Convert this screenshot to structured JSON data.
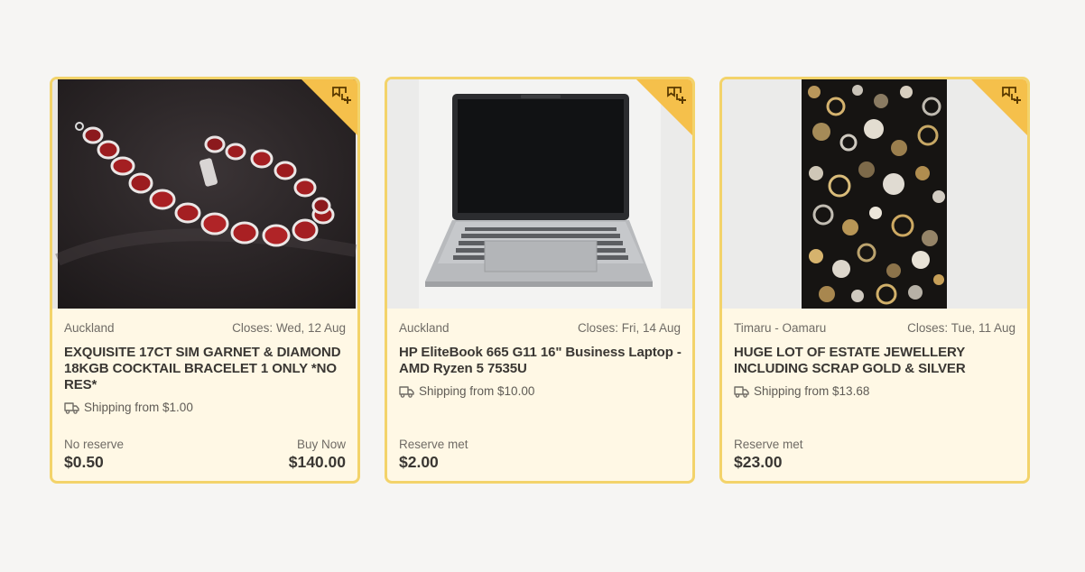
{
  "listings": [
    {
      "location": "Auckland",
      "closes": "Closes: Wed, 12 Aug",
      "title": "EXQUISITE 17CT SIM GARNET & DIAMOND 18KGB COCKTAIL BRACELET 1 ONLY *NO RES*",
      "shipping": "Shipping from $1.00",
      "price_label": "No reserve",
      "price": "$0.50",
      "buy_label": "Buy Now",
      "buy_price": "$140.00",
      "image": "garnet-bracelet-photo",
      "badge_icon": "watchlist-add-icon"
    },
    {
      "location": "Auckland",
      "closes": "Closes: Fri, 14 Aug",
      "title": "HP EliteBook 665 G11 16\" Business Laptop - AMD Ryzen 5 7535U",
      "shipping": "Shipping from $10.00",
      "price_label": "Reserve met",
      "price": "$2.00",
      "image": "laptop-photo",
      "badge_icon": "watchlist-add-icon"
    },
    {
      "location": "Timaru - Oamaru",
      "closes": "Closes: Tue, 11 Aug",
      "title": "HUGE LOT OF ESTATE JEWELLERY INCLUDING SCRAP GOLD & SILVER",
      "shipping": "Shipping from $13.68",
      "price_label": "Reserve met",
      "price": "$23.00",
      "image": "jewellery-lot-photo",
      "badge_icon": "watchlist-add-icon"
    }
  ],
  "colors": {
    "card_bg": "#fff8e5",
    "card_border": "#f3d36a",
    "badge": "#f5c04b",
    "page_bg": "#f6f5f3"
  }
}
